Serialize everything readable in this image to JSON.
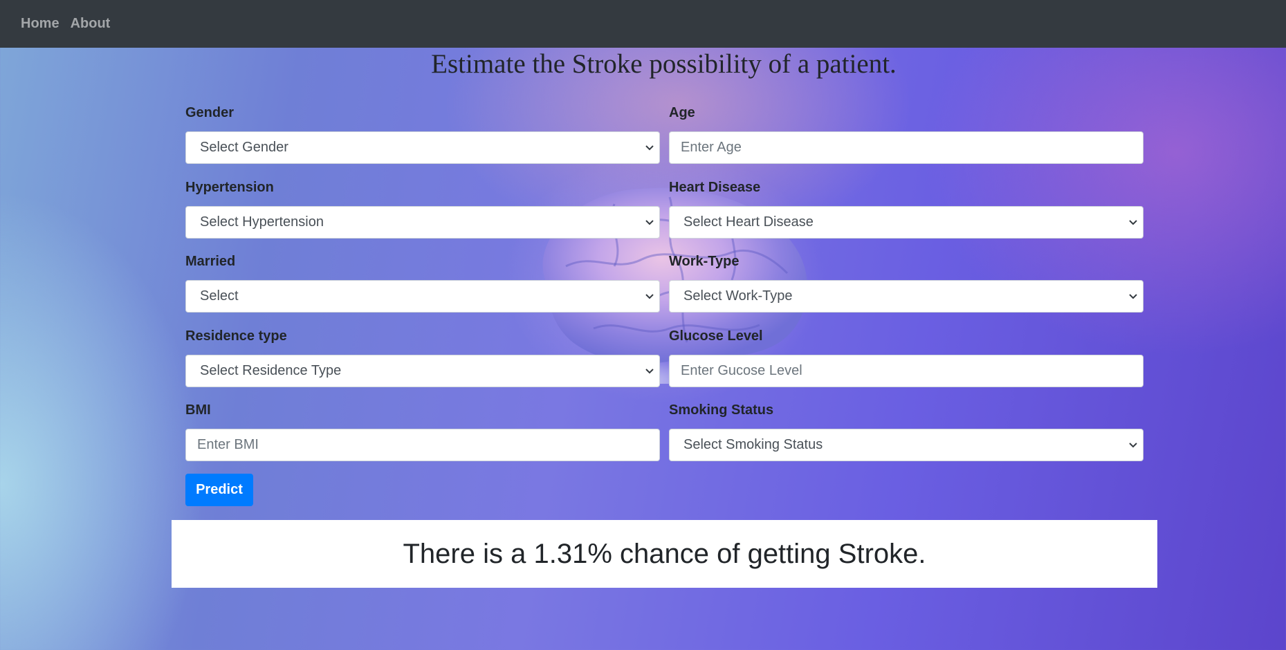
{
  "navbar": {
    "links": [
      {
        "label": "Home"
      },
      {
        "label": "About"
      }
    ]
  },
  "page": {
    "title": "Estimate the Stroke possibility of a patient."
  },
  "form": {
    "gender": {
      "label": "Gender",
      "value": "Select Gender"
    },
    "age": {
      "label": "Age",
      "placeholder": "Enter Age"
    },
    "hypertension": {
      "label": "Hypertension",
      "value": "Select Hypertension"
    },
    "heart_disease": {
      "label": "Heart Disease",
      "value": "Select Heart Disease"
    },
    "married": {
      "label": "Married",
      "value": "Select"
    },
    "work_type": {
      "label": "Work-Type",
      "value": "Select Work-Type"
    },
    "residence_type": {
      "label": "Residence type",
      "value": "Select Residence Type"
    },
    "glucose_level": {
      "label": "Glucose Level",
      "placeholder": "Enter Gucose Level"
    },
    "bmi": {
      "label": "BMI",
      "placeholder": "Enter BMI"
    },
    "smoking_status": {
      "label": "Smoking Status",
      "value": "Select Smoking Status"
    },
    "predict_label": "Predict"
  },
  "result": {
    "text": "There is a 1.31% chance of getting Stroke."
  },
  "colors": {
    "navbar": "#343a40",
    "primary": "#007bff",
    "background_accent": "#6a5fe2"
  },
  "icons": {
    "select_arrow": "chevron-down-icon",
    "background_image": "brain-illustration"
  }
}
